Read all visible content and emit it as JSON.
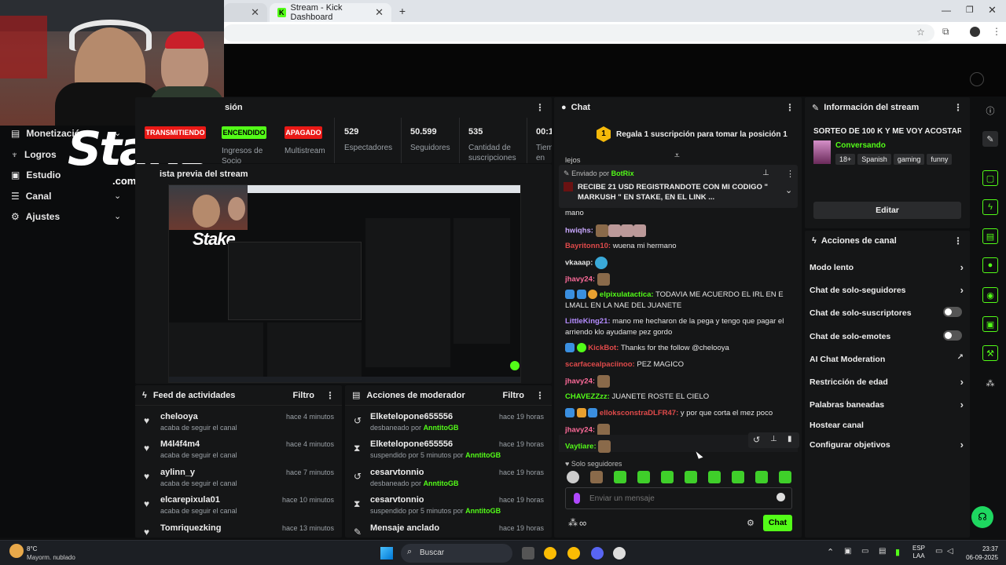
{
  "browser": {
    "tabs": [
      {
        "label": "Stream - Kick Dashboard"
      }
    ],
    "new_tab": "+"
  },
  "sidebar": {
    "items": [
      {
        "label": "Monetización"
      },
      {
        "label": "Logros"
      },
      {
        "label": "Estudio"
      },
      {
        "label": "Canal"
      },
      {
        "label": "Ajustes"
      }
    ]
  },
  "logo": {
    "brand": "Stake",
    "suffix": ".com"
  },
  "session": {
    "title": "sión",
    "badges": [
      {
        "label": "TRANSMITIENDO",
        "caption": "",
        "color": "#e91916"
      },
      {
        "label": "ENCENDIDO",
        "caption": "Ingresos de Socio",
        "color": "#53fc18"
      },
      {
        "label": "APAGADO",
        "caption": "Multistream",
        "color": "#e91916"
      }
    ],
    "stats": [
      {
        "value": "529",
        "label": "Espectadores"
      },
      {
        "value": "50.599",
        "label": "Seguidores"
      },
      {
        "value": "535",
        "label": "Cantidad de suscripciones"
      },
      {
        "value": "00:1",
        "label": "Tiem en vi"
      }
    ]
  },
  "preview": {
    "title": "ista previa del stream"
  },
  "feed": {
    "title": "Feed de actividades",
    "filter": "Filtro",
    "items": [
      {
        "name": "chelooya",
        "sub": "acaba de seguir el canal",
        "time": "hace 4 minutos"
      },
      {
        "name": "M4l4f4m4",
        "sub": "acaba de seguir el canal",
        "time": "hace 4 minutos"
      },
      {
        "name": "aylinn_y",
        "sub": "acaba de seguir el canal",
        "time": "hace 7 minutos"
      },
      {
        "name": "elcarepixula01",
        "sub": "acaba de seguir el canal",
        "time": "hace 10 minutos"
      },
      {
        "name": "Tomriquezking",
        "sub": "",
        "time": "hace 13 minutos"
      }
    ]
  },
  "modactions": {
    "title": "Acciones de moderador",
    "filter": "Filtro",
    "items": [
      {
        "name": "Elketelopone655556",
        "sub": "desbaneado por ",
        "by": "AnntitoGB",
        "time": "hace 19 horas",
        "icon": "undo-icon"
      },
      {
        "name": "Elketelopone655556",
        "sub": "suspendido por 5 minutos por ",
        "by": "AnntitoGB",
        "time": "hace 19 horas",
        "icon": "hourglass-icon"
      },
      {
        "name": "cesarvtonnio",
        "sub": "desbaneado por ",
        "by": "AnntitoGB",
        "time": "hace 19 horas",
        "icon": "undo-icon"
      },
      {
        "name": "cesarvtonnio",
        "sub": "suspendido por 5 minutos por ",
        "by": "AnntitoGB",
        "time": "hace 19 horas",
        "icon": "hourglass-icon"
      },
      {
        "name": "Mensaje anclado",
        "sub": "",
        "by": "",
        "time": "hace 19 horas",
        "icon": "pin-icon"
      }
    ]
  },
  "chat": {
    "title": "Chat",
    "subgoal": {
      "position": "1",
      "text": "Regala 1 suscripción para tomar la posición 1"
    },
    "pinned": {
      "by_label": "Enviado por",
      "by_user": "BotRix",
      "text": "RECIBE 21 USD REGISTRANDOTE CON MI CODIGO \" MARKUSH \" EN STAKE, EN EL LINK",
      "ellipsis": "..."
    },
    "above_text": "lejos",
    "messages": [
      {
        "user": "",
        "text": "mano",
        "color": "#e6e6e6"
      },
      {
        "user": "hwiqhs:",
        "text": "",
        "color": "#c9a8ff"
      },
      {
        "user": "Bayritonn10:",
        "text": "wuena mi hermano",
        "color": "#e04a4a"
      },
      {
        "user": "vkaaap:",
        "text": "",
        "color": "#e6e6e6"
      },
      {
        "user": "jhavy24:",
        "text": "",
        "color": "#ff6b9a"
      },
      {
        "user": "elpixulatactica:",
        "text": "TODAVIA ME ACUERDO EL IRL EN E LMALL EN LA NAE DEL JUANETE",
        "color": "#53fc18"
      },
      {
        "user": "LittleKing21:",
        "text": "mano me hecharon de la pega y tengo que pagar el arriendo klo ayudame pez gordo",
        "color": "#b48cff"
      },
      {
        "user": "KickBot:",
        "text": "Thanks for the follow @chelooya",
        "color": "#e04a4a"
      },
      {
        "user": "scarfacealpaciinoo:",
        "text": "PEZ MAGICO",
        "color": "#e04a4a"
      },
      {
        "user": "jhavy24:",
        "text": "",
        "color": "#ff6b9a"
      },
      {
        "user": "CHAVEZZzz:",
        "text": "JUANETE ROSTE EL CIELO",
        "color": "#53fc18"
      },
      {
        "user": "elloksconstraDLFR47:",
        "text": "y por que corta el mez poco",
        "color": "#e04a4a"
      },
      {
        "user": "jhavy24:",
        "text": "",
        "color": "#ff6b9a"
      },
      {
        "user": "Vaytiare:",
        "text": "",
        "color": "#53fc18"
      }
    ],
    "mode": "Solo seguidores",
    "input_placeholder": "Enviar un mensaje",
    "send": "Chat"
  },
  "info": {
    "title": "Información del stream",
    "stream_title": "SORTEO DE 100 K Y ME VOY ACOSTAR :(",
    "category": "Conversando",
    "tags": [
      "18+",
      "Spanish",
      "gaming",
      "funny"
    ],
    "edit": "Editar"
  },
  "actions": {
    "title": "Acciones de canal",
    "items": [
      {
        "label": "Modo lento",
        "kind": "chevron"
      },
      {
        "label": "Chat de solo-seguidores",
        "kind": "chevron"
      },
      {
        "label": "Chat de solo-suscriptores",
        "kind": "toggle"
      },
      {
        "label": "Chat de solo-emotes",
        "kind": "toggle"
      },
      {
        "label": "AI Chat Moderation",
        "kind": "external"
      },
      {
        "label": "Restricción de edad",
        "kind": "chevron"
      },
      {
        "label": "Palabras baneadas",
        "kind": "chevron"
      },
      {
        "label": "Hostear canal",
        "kind": "none"
      },
      {
        "label": "Configurar objetivos",
        "kind": "chevron"
      }
    ]
  },
  "taskbar": {
    "weather_temp": "8°C",
    "weather_desc": "Mayorm. nublado",
    "search": "Buscar",
    "lang1": "ESP",
    "lang2": "LAA",
    "time": "23:37",
    "date": "06-09-2025"
  },
  "colors": {
    "kick_green": "#53fc18",
    "live_red": "#e91916",
    "panel": "#151617"
  }
}
